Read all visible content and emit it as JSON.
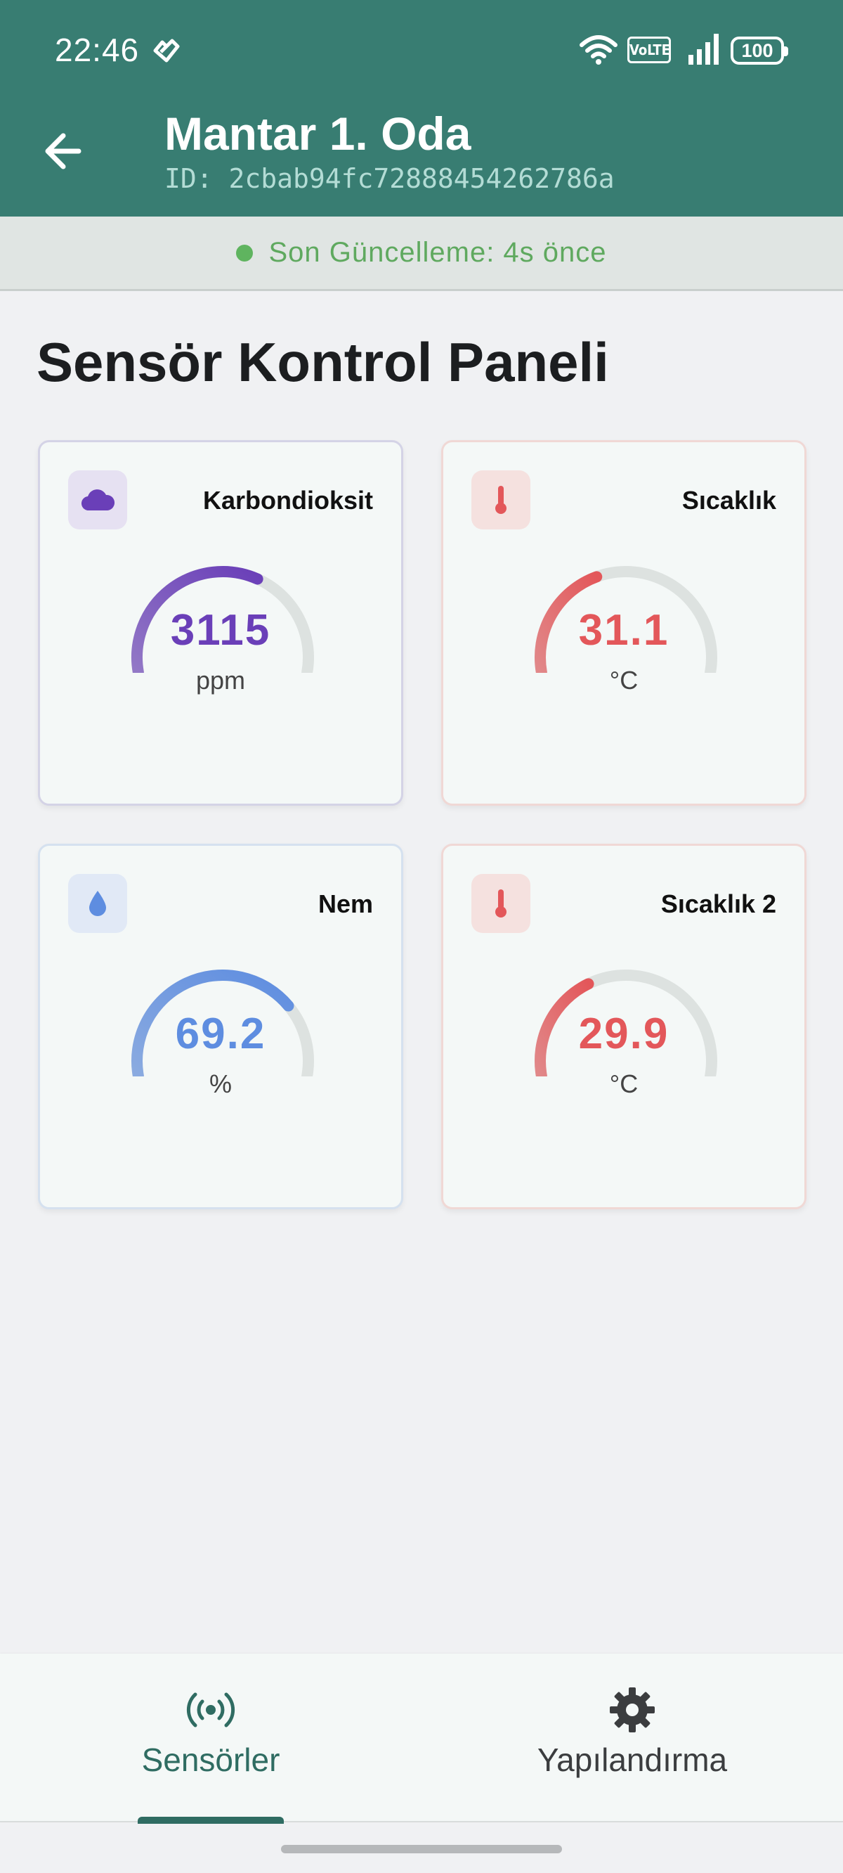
{
  "status_bar": {
    "time": "22:46",
    "volte": "VoLTE",
    "battery": "100"
  },
  "header": {
    "title": "Mantar 1. Oda",
    "device_id": "ID: 2cbab94fc72888454262786a"
  },
  "banner": {
    "text": "Son Güncelleme: 4s önce",
    "color": "#5fa95f"
  },
  "panel": {
    "title": "Sensör Kontrol Paneli"
  },
  "sensors": [
    {
      "label": "Karbondioksit",
      "value": "3115",
      "unit": "ppm",
      "icon": "cloud-icon",
      "color": "#6a3fb8",
      "gauge_fraction": 0.62
    },
    {
      "label": "Sıcaklık",
      "value": "31.1",
      "unit": "°C",
      "icon": "thermometer-icon",
      "color": "#e3575a",
      "gauge_fraction": 0.4
    },
    {
      "label": "Nem",
      "value": "69.2",
      "unit": "%",
      "icon": "water-drop-icon",
      "color": "#5e8de0",
      "gauge_fraction": 0.75
    },
    {
      "label": "Sıcaklık 2",
      "value": "29.9",
      "unit": "°C",
      "icon": "thermometer-icon",
      "color": "#e3575a",
      "gauge_fraction": 0.37
    }
  ],
  "bottom_nav": [
    {
      "label": "Sensörler",
      "icon": "broadcast-icon",
      "active": true
    },
    {
      "label": "Yapılandırma",
      "icon": "gear-icon",
      "active": false
    }
  ]
}
